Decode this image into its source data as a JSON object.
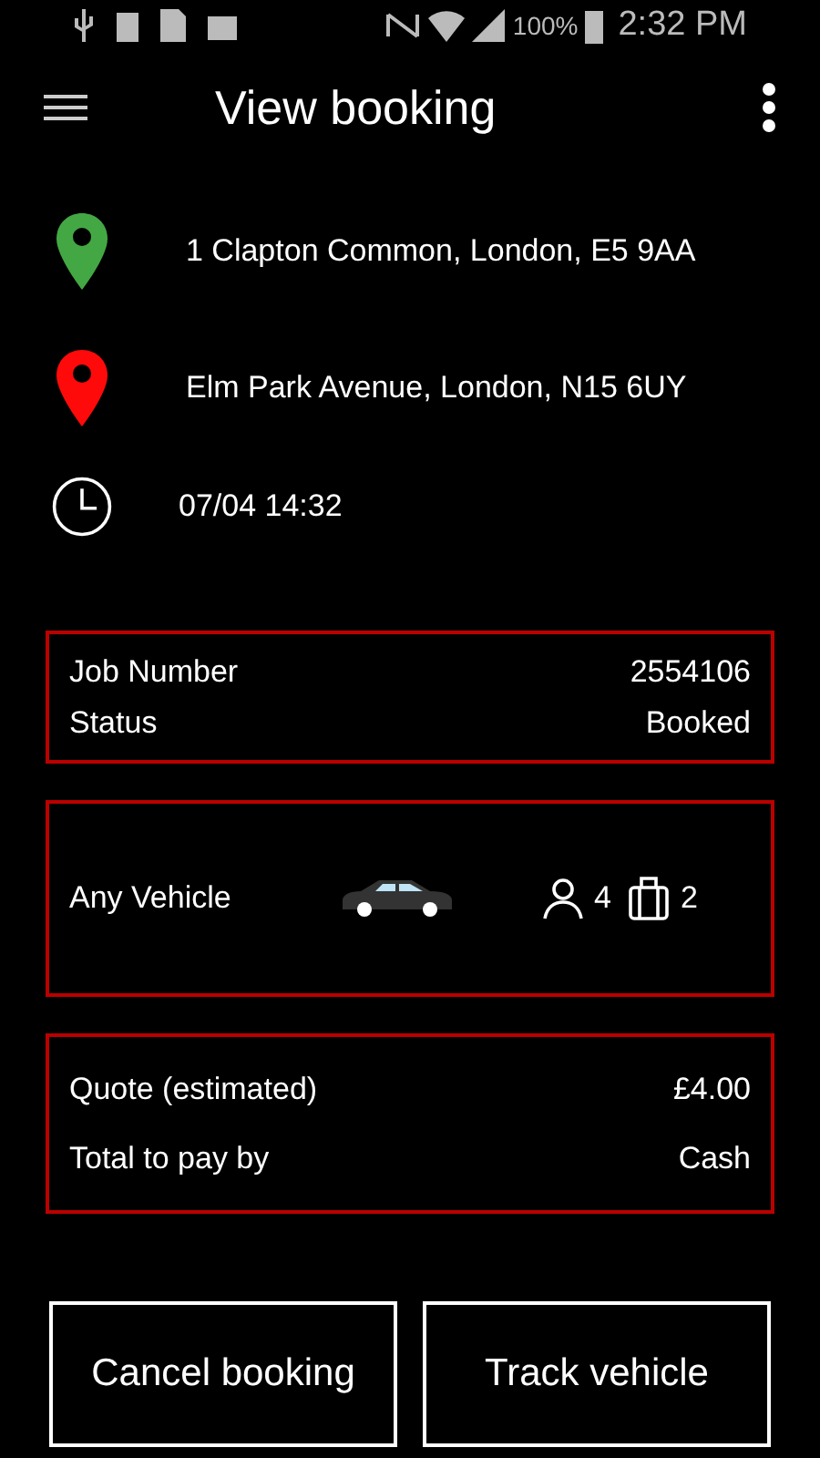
{
  "status_bar": {
    "battery_percent": "100%",
    "time": "2:32 PM"
  },
  "header": {
    "title": "View booking"
  },
  "route": [
    {
      "kind": "pin",
      "color": "#43a843",
      "text": "1 Clapton Common, London, E5 9AA"
    },
    {
      "kind": "pin",
      "color": "#ff0a0a",
      "text": "Elm Park Avenue, London, N15 6UY"
    },
    {
      "kind": "time",
      "text": "07/04 14:32"
    }
  ],
  "job": [
    {
      "label": "Job Number",
      "value": "2554106"
    },
    {
      "label": "Status",
      "value": "Booked"
    }
  ],
  "vehicle": {
    "name": "Any Vehicle",
    "passengers": "4",
    "luggage": "2"
  },
  "payment": [
    {
      "label": "Quote (estimated)",
      "value": "£4.00"
    },
    {
      "label": "Total to pay by",
      "value": "Cash"
    }
  ],
  "buttons": [
    "Cancel booking",
    "Track vehicle"
  ]
}
